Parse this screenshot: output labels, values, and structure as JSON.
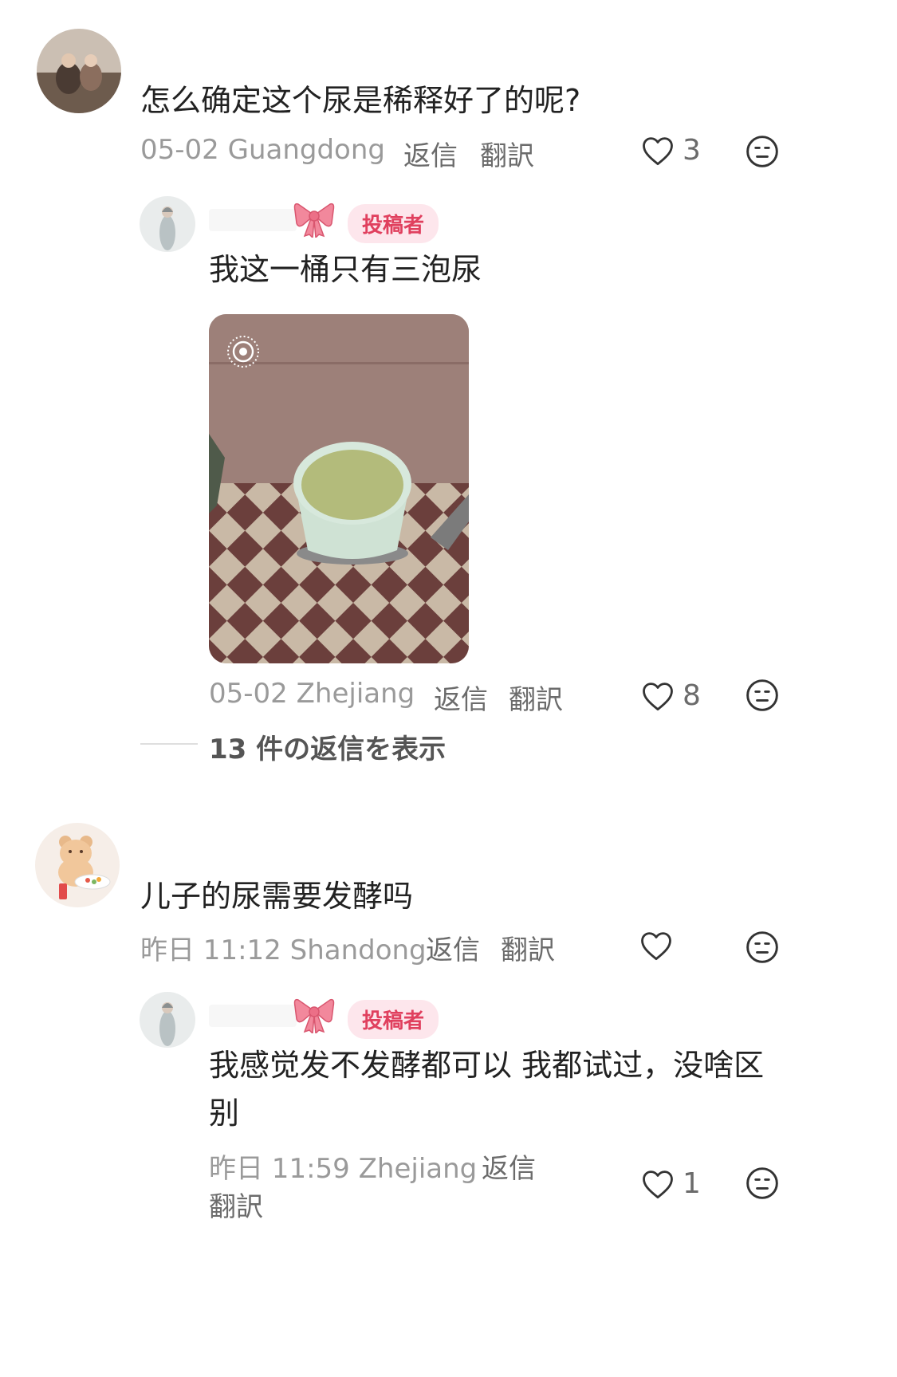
{
  "comments": [
    {
      "text": "怎么确定这个尿是稀释好了的呢?",
      "date": "05-02",
      "location": "Guangdong",
      "reply_label": "返信",
      "translate_label": "翻訳",
      "likes": "3",
      "reply": {
        "badge": "投稿者",
        "text": "我这一桶只有三泡尿",
        "date": "05-02",
        "location": "Zhejiang",
        "reply_label": "返信",
        "translate_label": "翻訳",
        "likes": "8",
        "show_replies": "13 件の返信を表示"
      }
    },
    {
      "text": "儿子的尿需要发酵吗",
      "date": "昨日 11:12",
      "location": "Shandong",
      "reply_label": "返信",
      "translate_label": "翻訳",
      "likes": "",
      "reply": {
        "badge": "投稿者",
        "text_line1": "我感觉发不发酵都可以 我都试过，没啥区",
        "text_line2": "别",
        "date": "昨日 11:59",
        "location": "Zhejiang",
        "reply_label": "返信",
        "translate_label": "翻訳",
        "likes": "1"
      }
    }
  ],
  "icons": {
    "like": "heart-outline-icon",
    "dislike": "neutral-face-icon",
    "live_photo": "live-photo-icon",
    "badge_decoration": "pink-bow-icon"
  },
  "colors": {
    "badge_bg": "#fde6ec",
    "badge_text": "#e0405e",
    "meta_text": "#9a9a9a"
  }
}
